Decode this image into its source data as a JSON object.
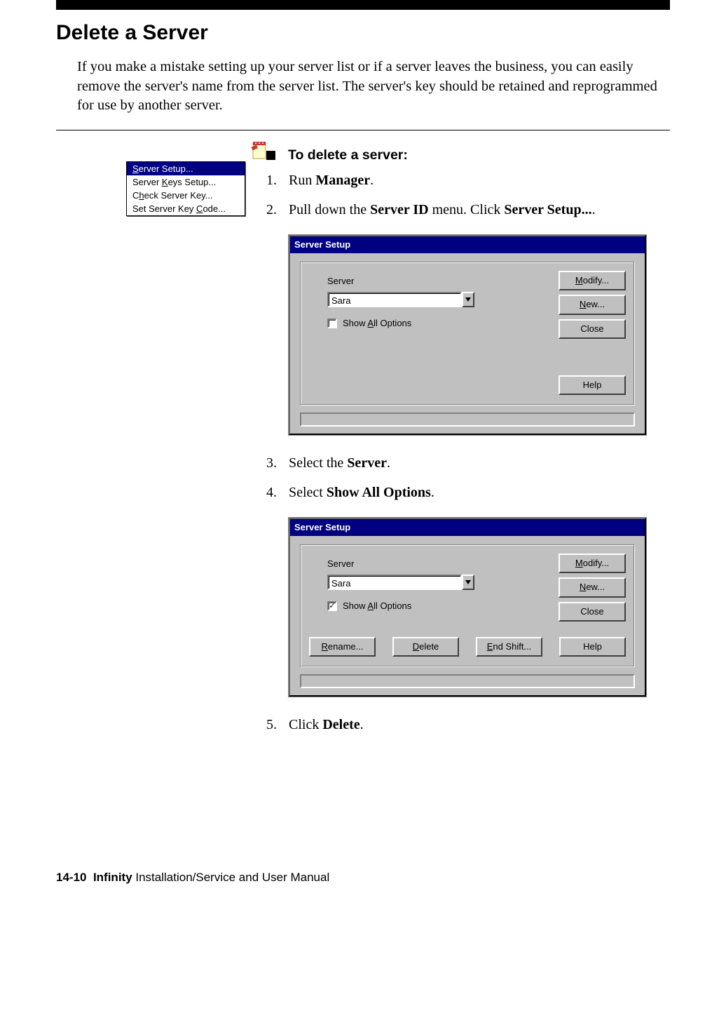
{
  "heading": "Delete a Server",
  "intro": "If you make a mistake setting up your server list or if a server leaves the business, you can easily remove the server's name from the server list. The server's key should be retained and reprogrammed for use by another server.",
  "procedure_title": "To delete a server:",
  "steps": {
    "s1_pre": "Run ",
    "s1_b": "Manager",
    "s1_post": ".",
    "s2_pre": "Pull down the ",
    "s2_b1": "Server ID",
    "s2_mid": " menu. Click ",
    "s2_b2": "Server Setup...",
    "s2_post": ".",
    "s3_pre": "Select the ",
    "s3_b": "Server",
    "s3_post": ".",
    "s4_pre": "Select ",
    "s4_b": "Show All Options",
    "s4_post": ".",
    "s5_pre": "Click ",
    "s5_b": "Delete",
    "s5_post": "."
  },
  "menu": {
    "items": [
      {
        "pre": "",
        "u": "S",
        "post": "erver Setup..."
      },
      {
        "pre": "Server ",
        "u": "K",
        "post": "eys Setup..."
      },
      {
        "pre": "C",
        "u": "h",
        "post": "eck Server Key..."
      },
      {
        "pre": "Set Server Key ",
        "u": "C",
        "post": "ode..."
      }
    ]
  },
  "dlg": {
    "title": "Server Setup",
    "server_label": "Server",
    "server_value": "Sara",
    "show_all_pre": "Show ",
    "show_all_u": "A",
    "show_all_post": "ll Options",
    "btn_modify_u": "M",
    "btn_modify_post": "odify...",
    "btn_new_u": "N",
    "btn_new_post": "ew...",
    "btn_close": "Close",
    "btn_help": "Help",
    "btn_rename_u": "R",
    "btn_rename_post": "ename...",
    "btn_delete_u": "D",
    "btn_delete_post": "elete",
    "btn_endshift_u": "E",
    "btn_endshift_post": "nd Shift..."
  },
  "footer": {
    "page_num": "14-10",
    "product": "Infinity",
    "rest": " Installation/Service and User Manual"
  }
}
